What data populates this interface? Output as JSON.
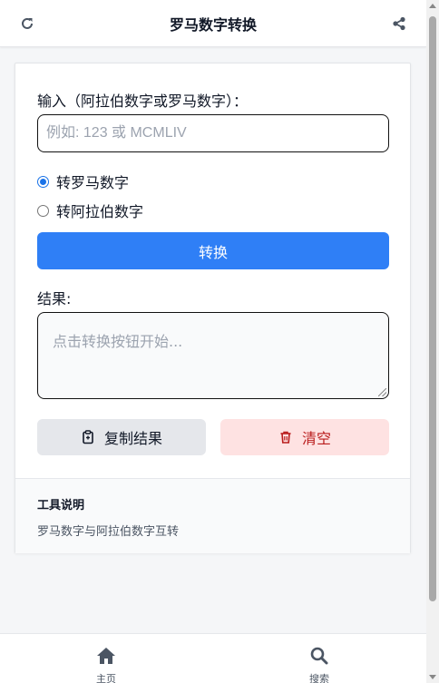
{
  "header": {
    "title": "罗马数字转换",
    "refresh_icon": "refresh-icon",
    "share_icon": "share-icon"
  },
  "form": {
    "input_label": "输入（阿拉伯数字或罗马数字）：",
    "input_value": "",
    "input_placeholder": "例如: 123 或 MCMLIV",
    "options": [
      {
        "label": "转罗马数字",
        "selected": true
      },
      {
        "label": "转阿拉伯数字",
        "selected": false
      }
    ],
    "convert_label": "转换",
    "result_label": "结果:",
    "result_placeholder": "点击转换按钮开始..."
  },
  "actions": {
    "copy_label": "复制结果",
    "copy_icon": "clipboard-icon",
    "clear_label": "清空",
    "clear_icon": "trash-icon"
  },
  "description": {
    "title": "工具说明",
    "text": "罗马数字与阿拉伯数字互转"
  },
  "nav": {
    "items": [
      {
        "label": "主页",
        "icon": "home-icon"
      },
      {
        "label": "搜索",
        "icon": "search-icon"
      }
    ]
  },
  "colors": {
    "primary": "#2f7ff6",
    "danger_bg": "#fee2e2",
    "danger_text": "#b91c1c",
    "neutral_bg": "#e5e7eb"
  }
}
